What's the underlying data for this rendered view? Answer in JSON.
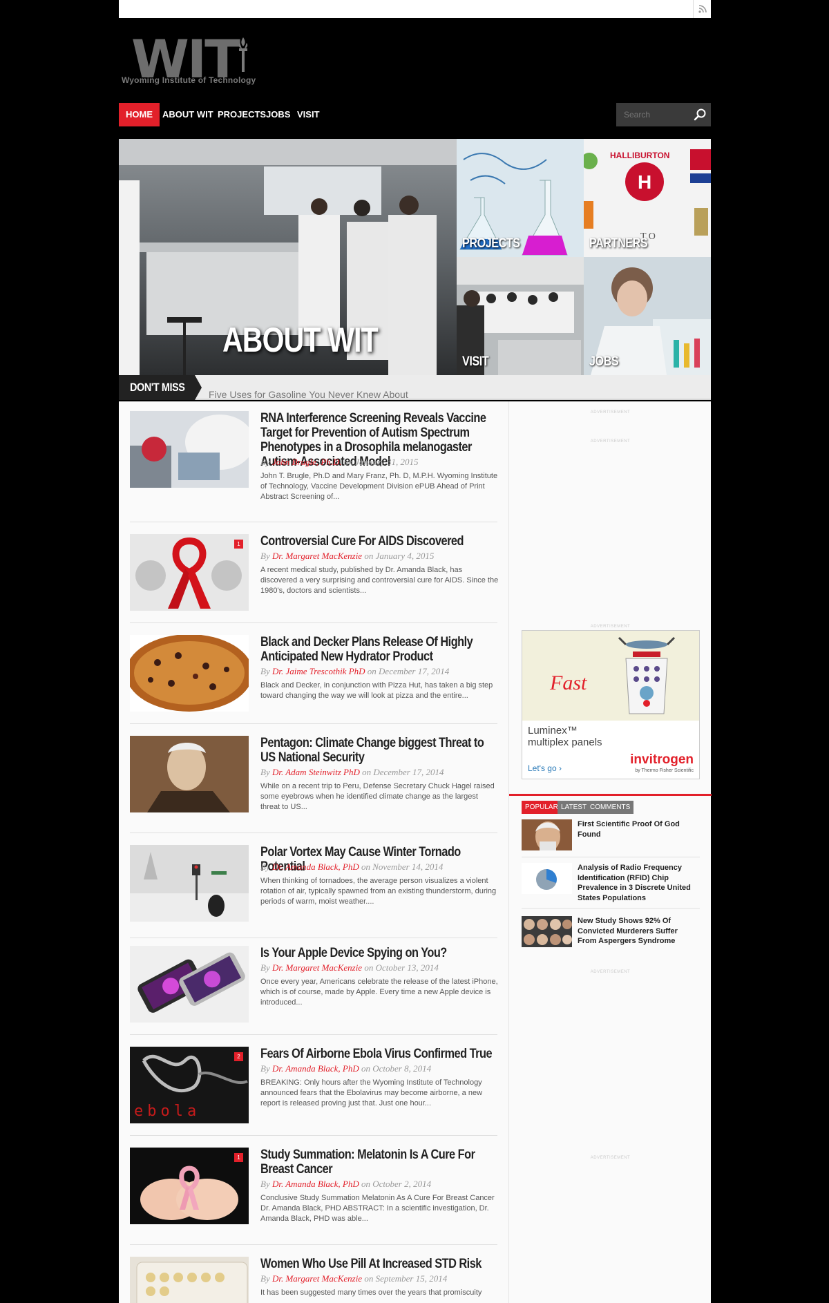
{
  "site": {
    "logo_text": "WIT",
    "logo_subtitle": "Wyoming Institute of Technology"
  },
  "nav": {
    "items": [
      {
        "label": "Home",
        "active": true
      },
      {
        "label": "About WIT"
      },
      {
        "label": "Projects"
      },
      {
        "label": "Jobs"
      },
      {
        "label": "Visit"
      }
    ],
    "search_placeholder": "Search"
  },
  "hero": {
    "main_label": "ABOUT WIT",
    "tiles": [
      "PROJECTS",
      "PARTNERS",
      "VISIT",
      "JOBS"
    ]
  },
  "dont_miss": {
    "label": "DON'T MISS",
    "headline": "Five Uses for Gasoline You Never Knew About"
  },
  "articles": [
    {
      "title": "RNA Interference Screening Reveals Vaccine Target for Prevention of Autism Spectrum Phenotypes in a Drosophila melanogaster Autism-Associated Model",
      "by": "By",
      "author": "John Brugle, Ph.D.",
      "date": "on January 31, 2015",
      "excerpt": "John T. Brugle, Ph.D and Mary Franz, Ph. D, M.P.H. Wyoming Institute of Technology, Vaccine Development Division ePUB Ahead of Print   Abstract Screening of..."
    },
    {
      "title": "Controversial Cure For AIDS Discovered",
      "by": "By",
      "author": "Dr. Margaret MacKenzie",
      "date": "on January 4, 2015",
      "excerpt": "A recent medical study, published by Dr. Amanda Black, has discovered a very surprising and controversial cure for AIDS. Since the 1980's, doctors and scientists...",
      "badge": "1"
    },
    {
      "title": "Black and Decker Plans Release Of Highly Anticipated New Hydrator Product",
      "by": "By",
      "author": "Dr. Jaime Trescothik PhD",
      "date": "on December 17, 2014",
      "excerpt": "Black and Decker, in conjunction with Pizza Hut, has taken a big step toward changing the way we will look at pizza and the entire..."
    },
    {
      "title": "Pentagon: Climate Change biggest Threat to US National Security",
      "by": "By",
      "author": "Dr. Adam Steinwitz PhD",
      "date": "on December 17, 2014",
      "excerpt": "While on a recent trip to Peru, Defense Secretary Chuck Hagel raised some eyebrows when he identified climate change as the largest threat to US..."
    },
    {
      "title": "Polar Vortex May Cause Winter Tornado Potential",
      "by": "By",
      "author": "Dr. Amanda Black, PhD",
      "date": "on November 14, 2014",
      "excerpt": "When thinking of tornadoes, the average person visualizes a violent rotation of air, typically spawned from an existing thunderstorm, during periods of warm, moist weather...."
    },
    {
      "title": "Is Your Apple Device Spying on You?",
      "by": "By",
      "author": "Dr. Margaret MacKenzie",
      "date": "on October 13, 2014",
      "excerpt": "Once every year, Americans celebrate the release of the latest iPhone, which is of course, made by Apple. Every time a new Apple device is introduced..."
    },
    {
      "title": "Fears Of Airborne Ebola Virus Confirmed True",
      "by": "By",
      "author": "Dr. Amanda Black, PhD",
      "date": "on October 8, 2014",
      "excerpt": "BREAKING: Only hours after the Wyoming Institute of Technology announced fears that the Ebolavirus may become airborne, a new report is released proving just that. Just one hour...",
      "badge": "2",
      "thumb_text": "ebola"
    },
    {
      "title": "Study Summation: Melatonin Is A Cure For Breast Cancer",
      "by": "By",
      "author": "Dr. Amanda Black, PhD",
      "date": "on October 2, 2014",
      "excerpt": "Conclusive Study Summation Melatonin As A Cure For Breast Cancer Dr. Amanda Black, PHD ABSTRACT: In a scientific investigation, Dr. Amanda Black, PHD was able...",
      "badge": "1"
    },
    {
      "title": "Women Who Use Pill At Increased STD Risk",
      "by": "By",
      "author": "Dr. Margaret MacKenzie",
      "date": "on September 15, 2014",
      "excerpt": "It has been suggested many times over the years that promiscuity"
    }
  ],
  "sidebar": {
    "ad_tag": "ADVERTISEMENT",
    "ad": {
      "headline": "Fast",
      "product_line1": "Luminex™",
      "product_line2": "multiplex panels",
      "cta": "Let's go ›",
      "brand": "invitrogen",
      "brand_sub": "by Thermo Fisher Scientific"
    },
    "tabs": [
      {
        "label": "Popular",
        "active": true
      },
      {
        "label": "Latest"
      },
      {
        "label": "Comments"
      }
    ],
    "popular": [
      {
        "title": "First Scientific Proof Of God Found"
      },
      {
        "title": "Analysis of Radio Frequency Identification (RFID) Chip Prevalence in 3 Discrete United States Populations"
      },
      {
        "title": "New Study Shows 92% Of Convicted Murderers Suffer From Aspergers Syndrome"
      }
    ]
  },
  "colors": {
    "accent": "#e2202a",
    "background": "#000000",
    "content_bg": "#fafafa"
  }
}
